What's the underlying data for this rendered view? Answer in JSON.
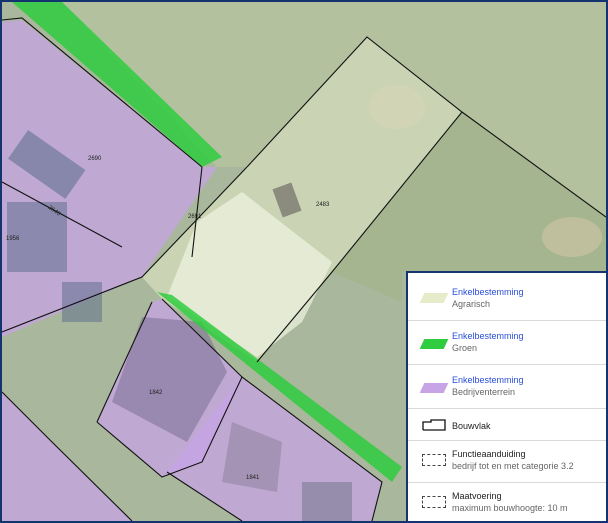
{
  "parcels": [
    {
      "id": "p2690",
      "label": "2690"
    },
    {
      "id": "p2691",
      "label": "2691"
    },
    {
      "id": "p2483",
      "label": "2483"
    },
    {
      "id": "p1842",
      "label": "1842"
    },
    {
      "id": "p1841",
      "label": "1841"
    },
    {
      "id": "p1956",
      "label": "1956"
    },
    {
      "id": "p2646",
      "label": "2646"
    }
  ],
  "colors": {
    "agrarisch": "#e6ecc9",
    "groen": "#2fcc3f",
    "bedrijventerrein": "#c7a4e6",
    "border": "#13346e"
  },
  "legend": {
    "items": [
      {
        "title": "Enkelbestemming",
        "subtitle": "Agrarisch",
        "symbol": "fill-agrarisch"
      },
      {
        "title": "Enkelbestemming",
        "subtitle": "Groen",
        "symbol": "fill-groen"
      },
      {
        "title": "Enkelbestemming",
        "subtitle": "Bedrijventerrein",
        "symbol": "fill-bedrijventerrein"
      },
      {
        "title": "Bouwvlak",
        "subtitle": "",
        "symbol": "outline-bouwvlak"
      },
      {
        "title": "Functieaanduiding",
        "subtitle": "bedrijf tot en met categorie 3.2",
        "symbol": "dashed-box"
      },
      {
        "title": "Maatvoering",
        "subtitle": "maximum bouwhoogte: 10 m",
        "symbol": "dashed-box"
      }
    ]
  }
}
